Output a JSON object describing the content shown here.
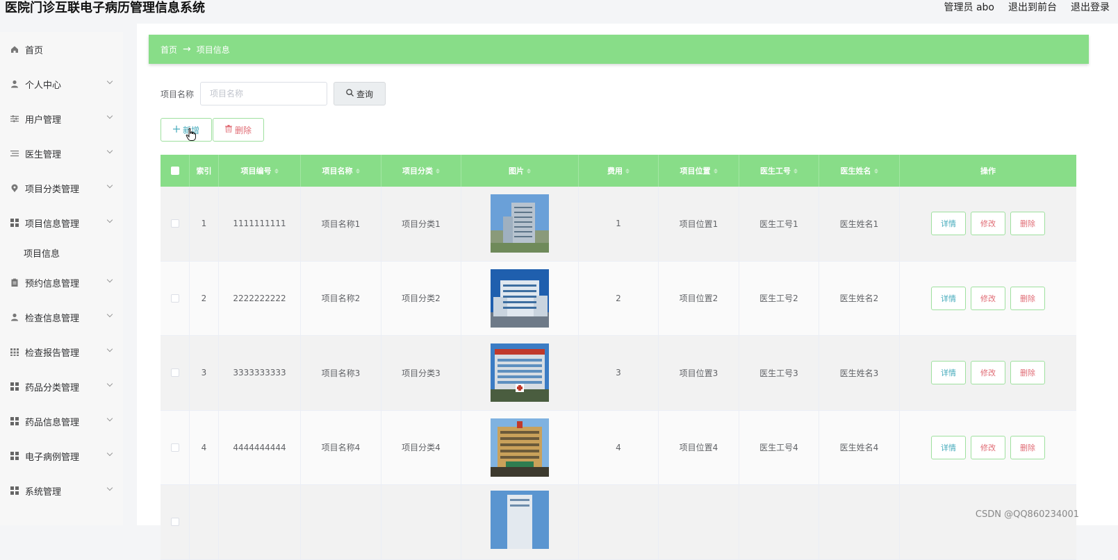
{
  "header": {
    "title": "医院门诊互联电子病历管理信息系统",
    "admin": "管理员 abo",
    "to_front": "退出到前台",
    "logout": "退出登录"
  },
  "sidebar": {
    "items": [
      {
        "label": "首页",
        "icon": "home-icon"
      },
      {
        "label": "个人中心",
        "icon": "user-icon"
      },
      {
        "label": "用户管理",
        "icon": "sliders-icon"
      },
      {
        "label": "医生管理",
        "icon": "list-icon"
      },
      {
        "label": "项目分类管理",
        "icon": "map-pin-icon"
      },
      {
        "label": "项目信息管理",
        "icon": "grid-icon"
      },
      {
        "label": "预约信息管理",
        "icon": "clipboard-icon"
      },
      {
        "label": "检查信息管理",
        "icon": "user-icon"
      },
      {
        "label": "检查报告管理",
        "icon": "dots-grid-icon"
      },
      {
        "label": "药品分类管理",
        "icon": "grid-icon"
      },
      {
        "label": "药品信息管理",
        "icon": "grid-icon"
      },
      {
        "label": "电子病例管理",
        "icon": "grid-icon"
      },
      {
        "label": "系统管理",
        "icon": "grid-icon"
      }
    ],
    "sub_item": "项目信息"
  },
  "breadcrumb": {
    "home": "首页",
    "arrow": "→",
    "current": "项目信息"
  },
  "search": {
    "label": "项目名称",
    "placeholder": "项目名称",
    "button": "查询"
  },
  "actions": {
    "add": "新增",
    "delete": "删除"
  },
  "table": {
    "headers": [
      "索引",
      "项目编号",
      "项目名称",
      "项目分类",
      "图片",
      "费用",
      "项目位置",
      "医生工号",
      "医生姓名",
      "操作"
    ],
    "rows": [
      {
        "index": "1",
        "code": "1111111111",
        "name": "项目名称1",
        "category": "项目分类1",
        "fee": "1",
        "location": "项目位置1",
        "doctor_no": "医生工号1",
        "doctor_name": "医生姓名1"
      },
      {
        "index": "2",
        "code": "2222222222",
        "name": "项目名称2",
        "category": "项目分类2",
        "fee": "2",
        "location": "项目位置2",
        "doctor_no": "医生工号2",
        "doctor_name": "医生姓名2"
      },
      {
        "index": "3",
        "code": "3333333333",
        "name": "项目名称3",
        "category": "项目分类3",
        "fee": "3",
        "location": "项目位置3",
        "doctor_no": "医生工号3",
        "doctor_name": "医生姓名3"
      },
      {
        "index": "4",
        "code": "4444444444",
        "name": "项目名称4",
        "category": "项目分类4",
        "fee": "4",
        "location": "项目位置4",
        "doctor_no": "医生工号4",
        "doctor_name": "医生姓名4"
      }
    ],
    "op_detail": "详情",
    "op_edit": "修改",
    "op_delete": "删除"
  },
  "watermark": "CSDN @QQ860234001",
  "colors": {
    "accent_green": "#88dd88",
    "link_blue": "#44aabb",
    "danger_red": "#e06c75"
  }
}
